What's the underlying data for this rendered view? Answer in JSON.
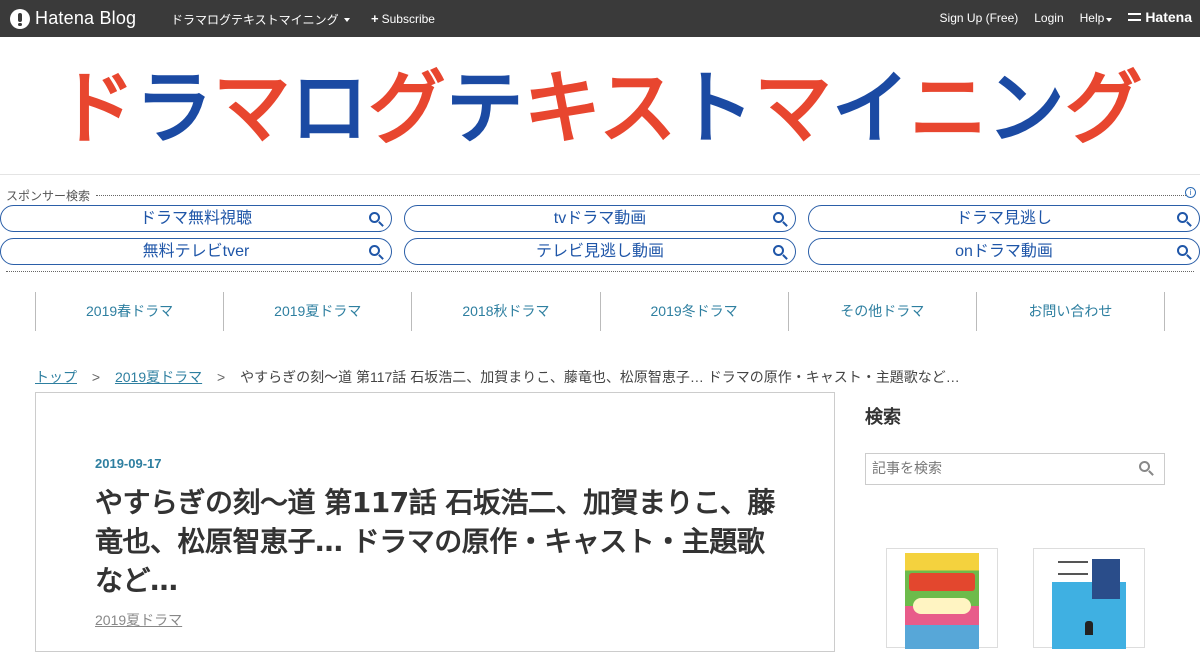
{
  "globalbar": {
    "logo_text": "Hatena Blog",
    "blog_name": "ドラマログテキストマイニング",
    "subscribe_label": "Subscribe",
    "signup_label": "Sign Up (Free)",
    "login_label": "Login",
    "help_label": "Help",
    "hatena_label": "Hatena"
  },
  "banner": {
    "title": "ドラマログテキストマイニング"
  },
  "sponsor": {
    "heading": "スポンサー検索",
    "info_icon": "i",
    "links": [
      "ドラマ無料視聴",
      "tvドラマ動画",
      "ドラマ見逃し",
      "無料テレビtver",
      "テレビ見逃し動画",
      "onドラマ動画"
    ]
  },
  "category_nav": [
    "2019春ドラマ",
    "2019夏ドラマ",
    "2018秋ドラマ",
    "2019冬ドラマ",
    "その他ドラマ",
    "お問い合わせ"
  ],
  "breadcrumb": {
    "top": "トップ",
    "separator": ">",
    "category": "2019夏ドラマ",
    "current": "やすらぎの刻～道 第117話 石坂浩二、加賀まりこ、藤竜也、松原智恵子… ドラマの原作・キャスト・主題歌など…"
  },
  "article": {
    "date": "2019-09-17",
    "title": "やすらぎの刻～道 第117話 石坂浩二、加賀まりこ、藤竜也、松原智恵子… ドラマの原作・キャスト・主題歌など…",
    "category": "2019夏ドラマ"
  },
  "sidebar": {
    "search_title": "検索",
    "search_placeholder": "記事を検索"
  },
  "colors": {
    "banner_red": "#e8462f",
    "banner_blue": "#1b4aa3",
    "link": "#2e7fa0",
    "globalbar_bg": "#3a3a3a"
  },
  "icons": [
    "hatena-blog-logo-icon",
    "caret-down-icon",
    "plus-icon",
    "search-icon",
    "info-icon",
    "hatena-mark-icon"
  ]
}
